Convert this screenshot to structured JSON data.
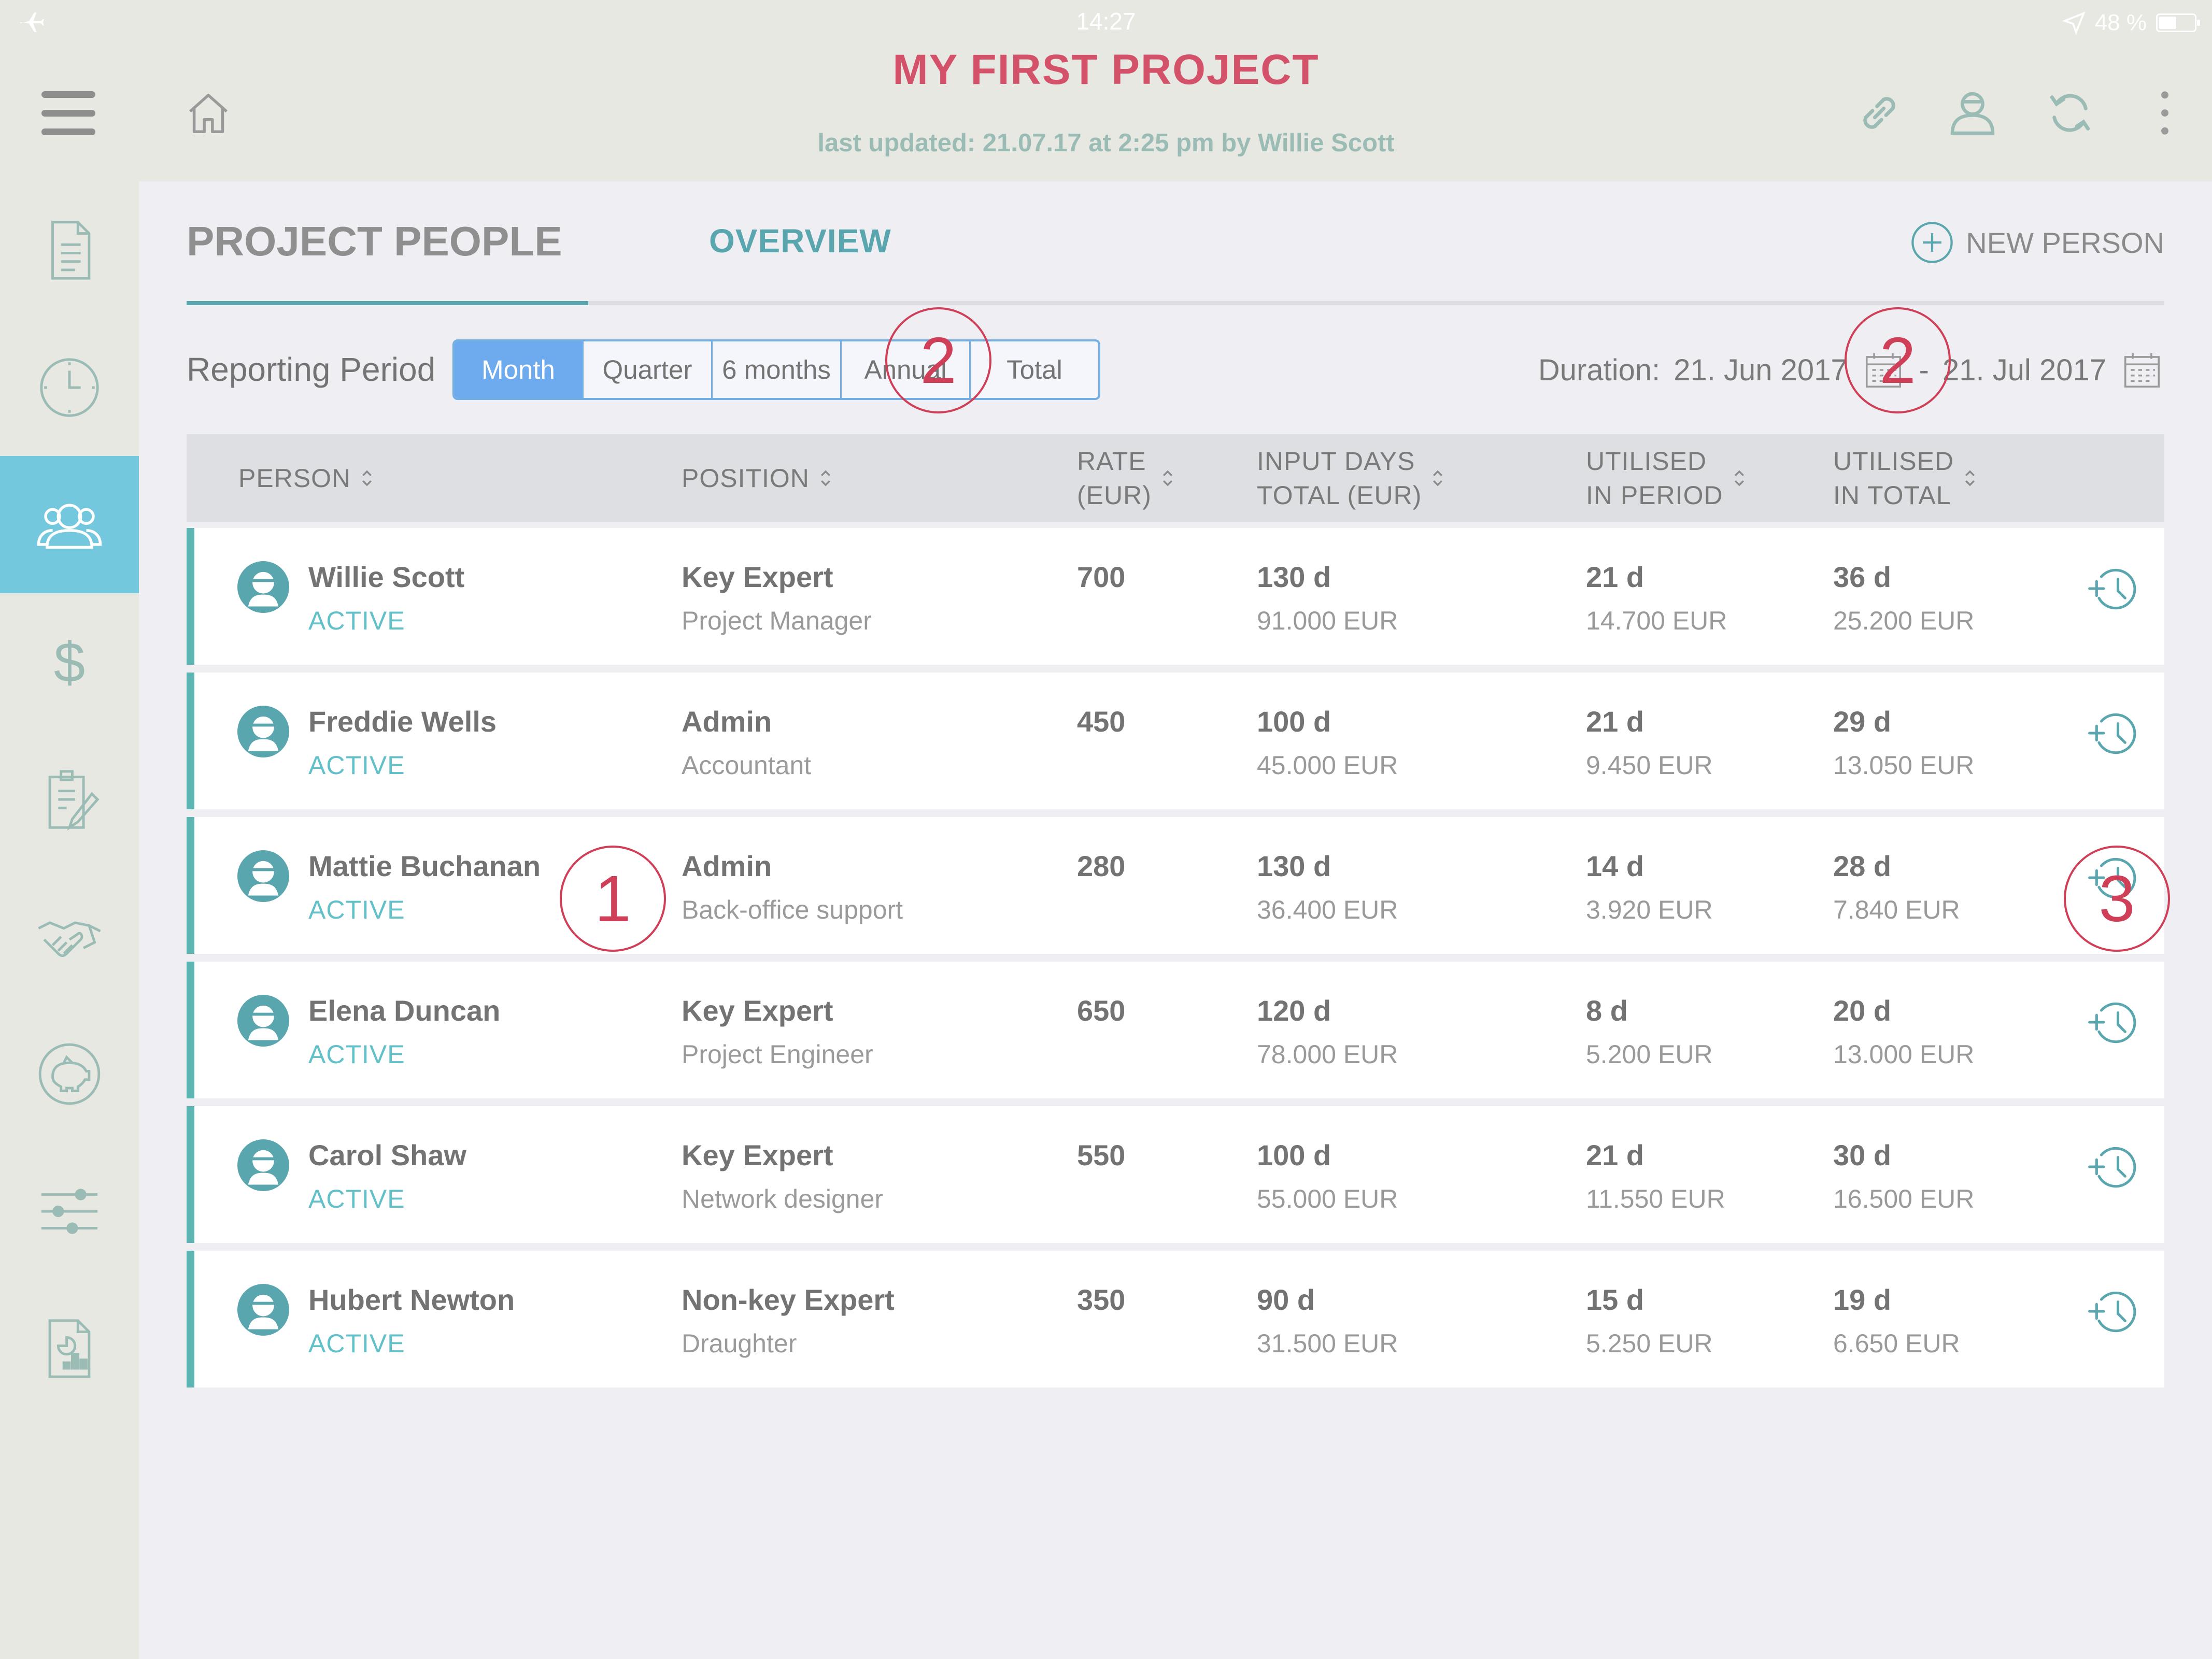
{
  "status_bar": {
    "time": "14:27",
    "battery": "48 %",
    "battery_level": 0.48
  },
  "header": {
    "title": "MY FIRST PROJECT",
    "last_updated": "last updated: 21.07.17 at 2:25 pm by Willie Scott",
    "actions": [
      "link-icon",
      "team-icon",
      "sync-icon",
      "more-vertical-icon"
    ]
  },
  "sidebar": {
    "items": [
      {
        "icon": "document-icon"
      },
      {
        "icon": "clock-icon"
      },
      {
        "icon": "people-icon",
        "active": true
      },
      {
        "icon": "dollar-icon"
      },
      {
        "icon": "clipboard-edit-icon"
      },
      {
        "icon": "handshake-icon"
      },
      {
        "icon": "piggy-bank-icon"
      },
      {
        "icon": "sliders-icon"
      },
      {
        "icon": "report-icon"
      }
    ]
  },
  "tabs": {
    "people": "PROJECT PEOPLE",
    "overview": "OVERVIEW",
    "active": "people"
  },
  "new_person": "NEW PERSON",
  "reporting": {
    "label": "Reporting Period",
    "options": [
      "Month",
      "Quarter",
      "6 months",
      "Annual",
      "Total"
    ],
    "selected": "Month"
  },
  "duration": {
    "label": "Duration:",
    "start": "21. Jun 2017",
    "separator": "-",
    "end": "21. Jul 2017"
  },
  "callouts": [
    "1",
    "2",
    "2",
    "3"
  ],
  "table": {
    "headers": {
      "person": "PERSON",
      "position": "POSITION",
      "rate_1": "RATE",
      "rate_2": "(EUR)",
      "input_1": "INPUT DAYS",
      "input_2": "TOTAL (EUR)",
      "period_1": "UTILISED",
      "period_2": "IN PERIOD",
      "total_1": "UTILISED",
      "total_2": "IN TOTAL"
    },
    "rows": [
      {
        "name": "Willie Scott",
        "status": "ACTIVE",
        "position": "Key Expert",
        "role": "Project Manager",
        "rate": "700",
        "input_days": "130 d",
        "input_total": "91.000 EUR",
        "period_days": "21 d",
        "period_total": "14.700 EUR",
        "total_days": "36 d",
        "total_total": "25.200 EUR"
      },
      {
        "name": "Freddie Wells",
        "status": "ACTIVE",
        "position": "Admin",
        "role": "Accountant",
        "rate": "450",
        "input_days": "100 d",
        "input_total": "45.000 EUR",
        "period_days": "21 d",
        "period_total": "9.450 EUR",
        "total_days": "29 d",
        "total_total": "13.050 EUR"
      },
      {
        "name": "Mattie Buchanan",
        "status": "ACTIVE",
        "position": "Admin",
        "role": "Back-office support",
        "rate": "280",
        "input_days": "130 d",
        "input_total": "36.400 EUR",
        "period_days": "14 d",
        "period_total": "3.920 EUR",
        "total_days": "28 d",
        "total_total": "7.840 EUR"
      },
      {
        "name": "Elena Duncan",
        "status": "ACTIVE",
        "position": "Key Expert",
        "role": "Project Engineer",
        "rate": "650",
        "input_days": "120 d",
        "input_total": "78.000 EUR",
        "period_days": "8 d",
        "period_total": "5.200 EUR",
        "total_days": "20 d",
        "total_total": "13.000 EUR"
      },
      {
        "name": "Carol Shaw",
        "status": "ACTIVE",
        "position": "Key Expert",
        "role": "Network designer",
        "rate": "550",
        "input_days": "100 d",
        "input_total": "55.000 EUR",
        "period_days": "21 d",
        "period_total": "11.550 EUR",
        "total_days": "30 d",
        "total_total": "16.500 EUR"
      },
      {
        "name": "Hubert Newton",
        "status": "ACTIVE",
        "position": "Non-key Expert",
        "role": "Draughter",
        "rate": "350",
        "input_days": "90 d",
        "input_total": "31.500 EUR",
        "period_days": "15 d",
        "period_total": "5.250 EUR",
        "total_days": "19 d",
        "total_total": "6.650 EUR"
      }
    ],
    "row_action_icon": "add-time-icon"
  },
  "colors": {
    "title": "#d4516a",
    "accent_teal": "#5aa6ae",
    "selected_segment": "#6daaee",
    "sidebar_active": "#73c8dd",
    "callout": "#cf3f57",
    "status_active": "#61c0c8"
  }
}
